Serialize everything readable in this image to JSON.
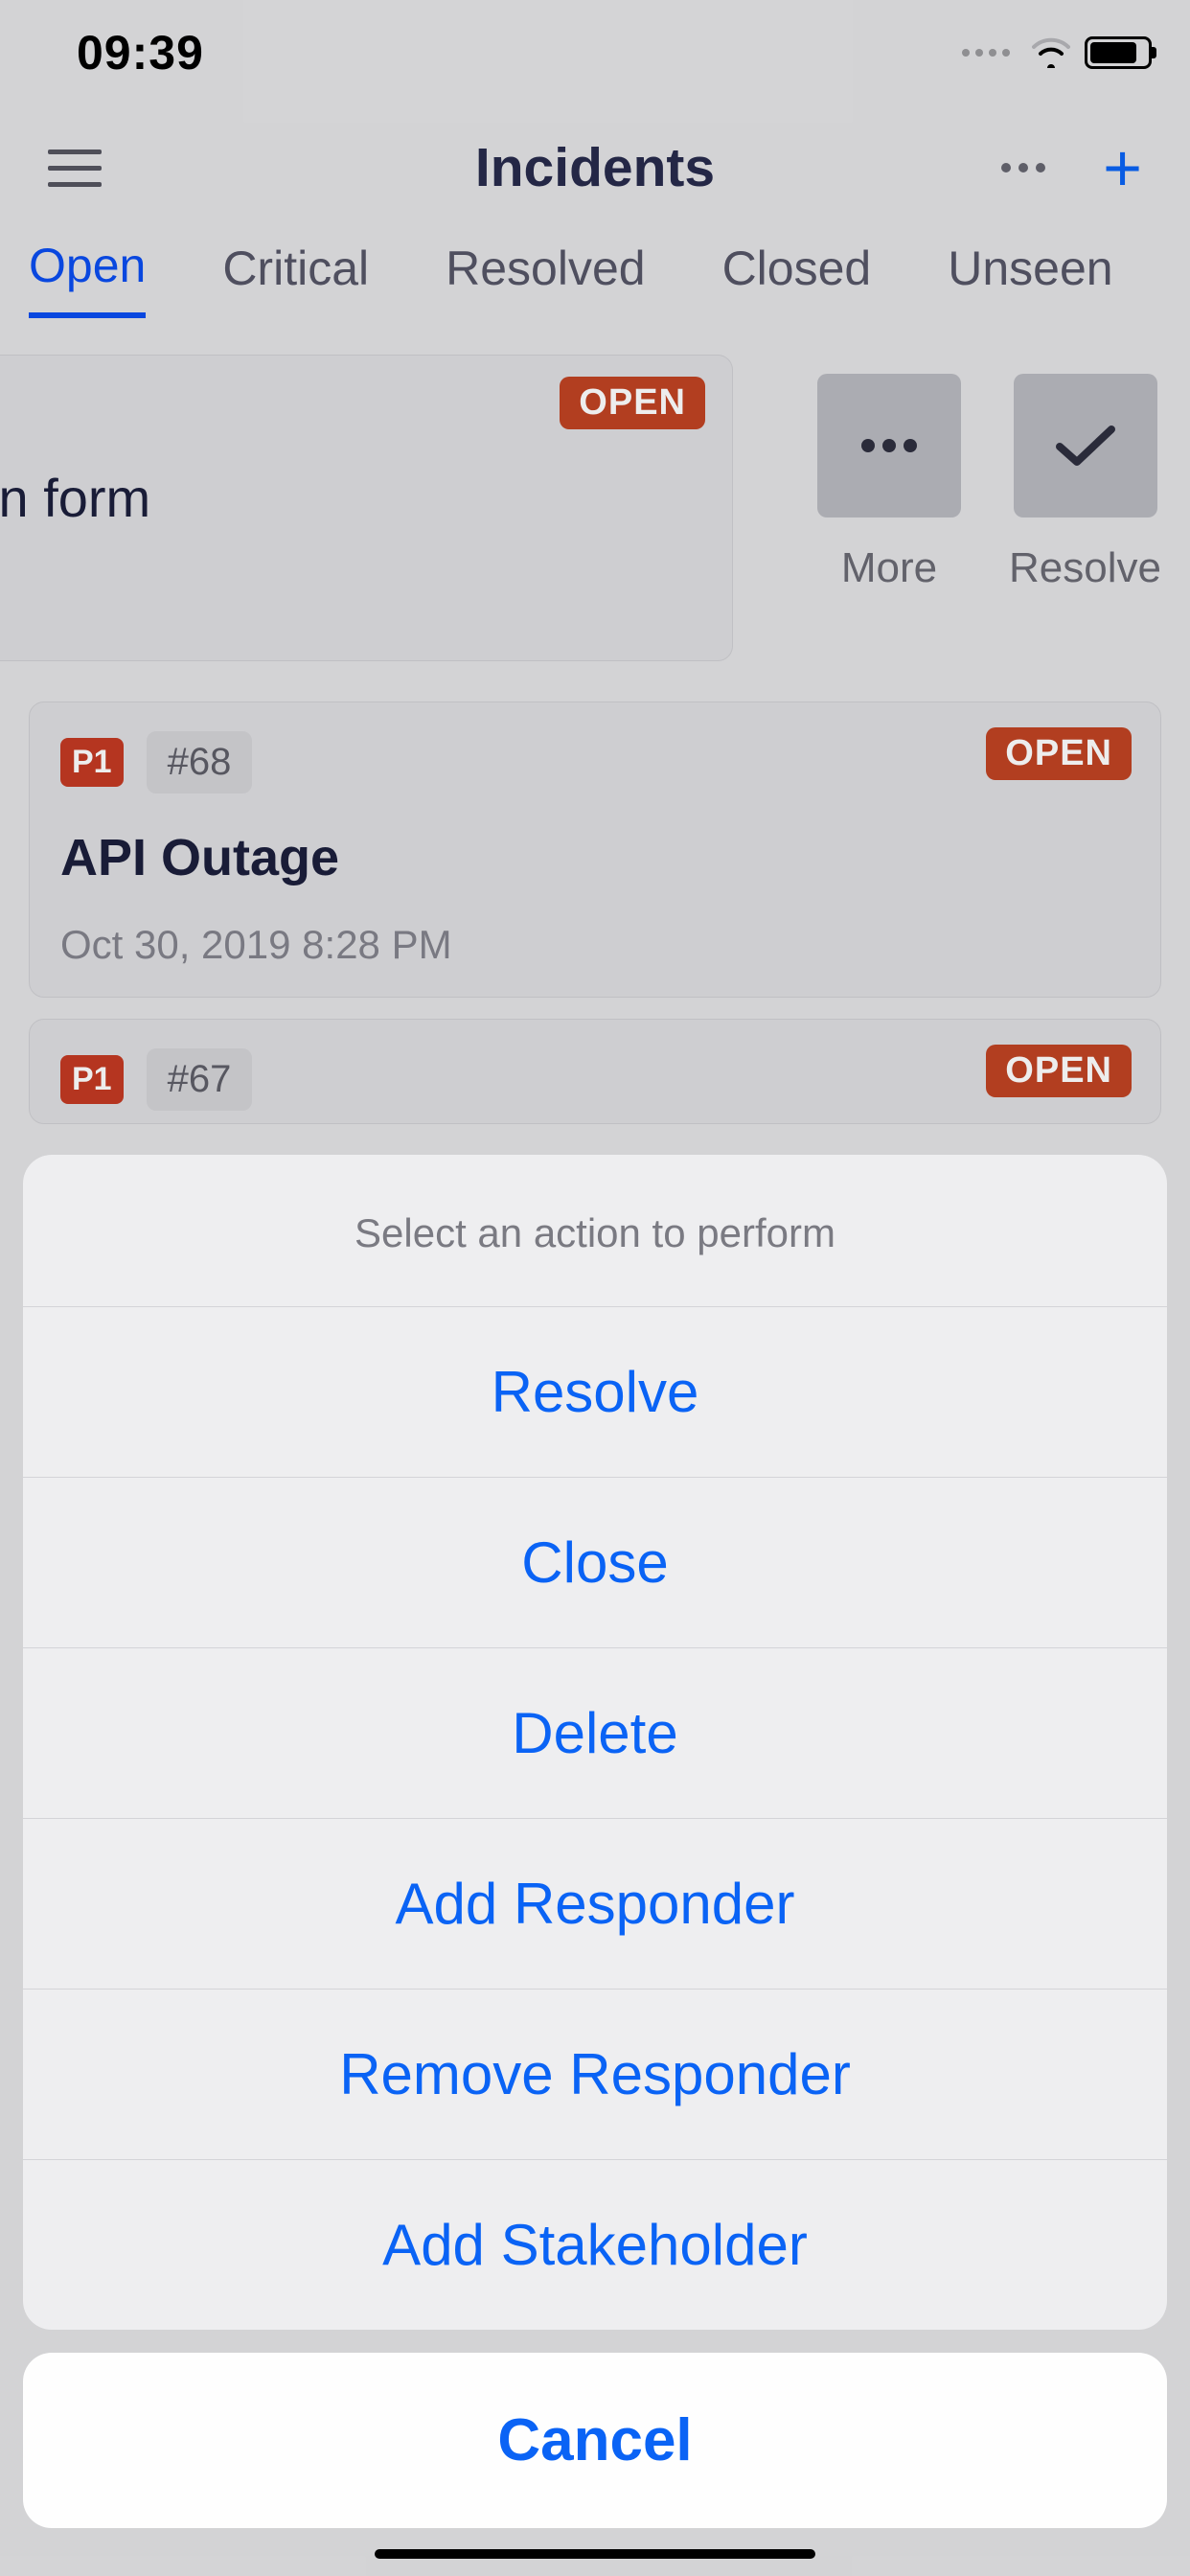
{
  "status_bar": {
    "time": "09:39"
  },
  "header": {
    "title": "Incidents"
  },
  "tabs": [
    "Open",
    "Critical",
    "Resolved",
    "Closed",
    "Unseen"
  ],
  "active_tab_index": 0,
  "swiped_card": {
    "title_fragment": "ates - Login form",
    "status": "OPEN",
    "actions": {
      "more": "More",
      "resolve": "Resolve"
    }
  },
  "incidents": [
    {
      "priority": "P1",
      "id": "#68",
      "status": "OPEN",
      "title": "API Outage",
      "timestamp": "Oct 30, 2019 8:28 PM"
    },
    {
      "priority": "P1",
      "id": "#67",
      "status": "OPEN"
    }
  ],
  "action_sheet": {
    "title": "Select an action to perform",
    "items": [
      "Resolve",
      "Close",
      "Delete",
      "Add Responder",
      "Remove Responder",
      "Add Stakeholder"
    ],
    "cancel": "Cancel"
  }
}
